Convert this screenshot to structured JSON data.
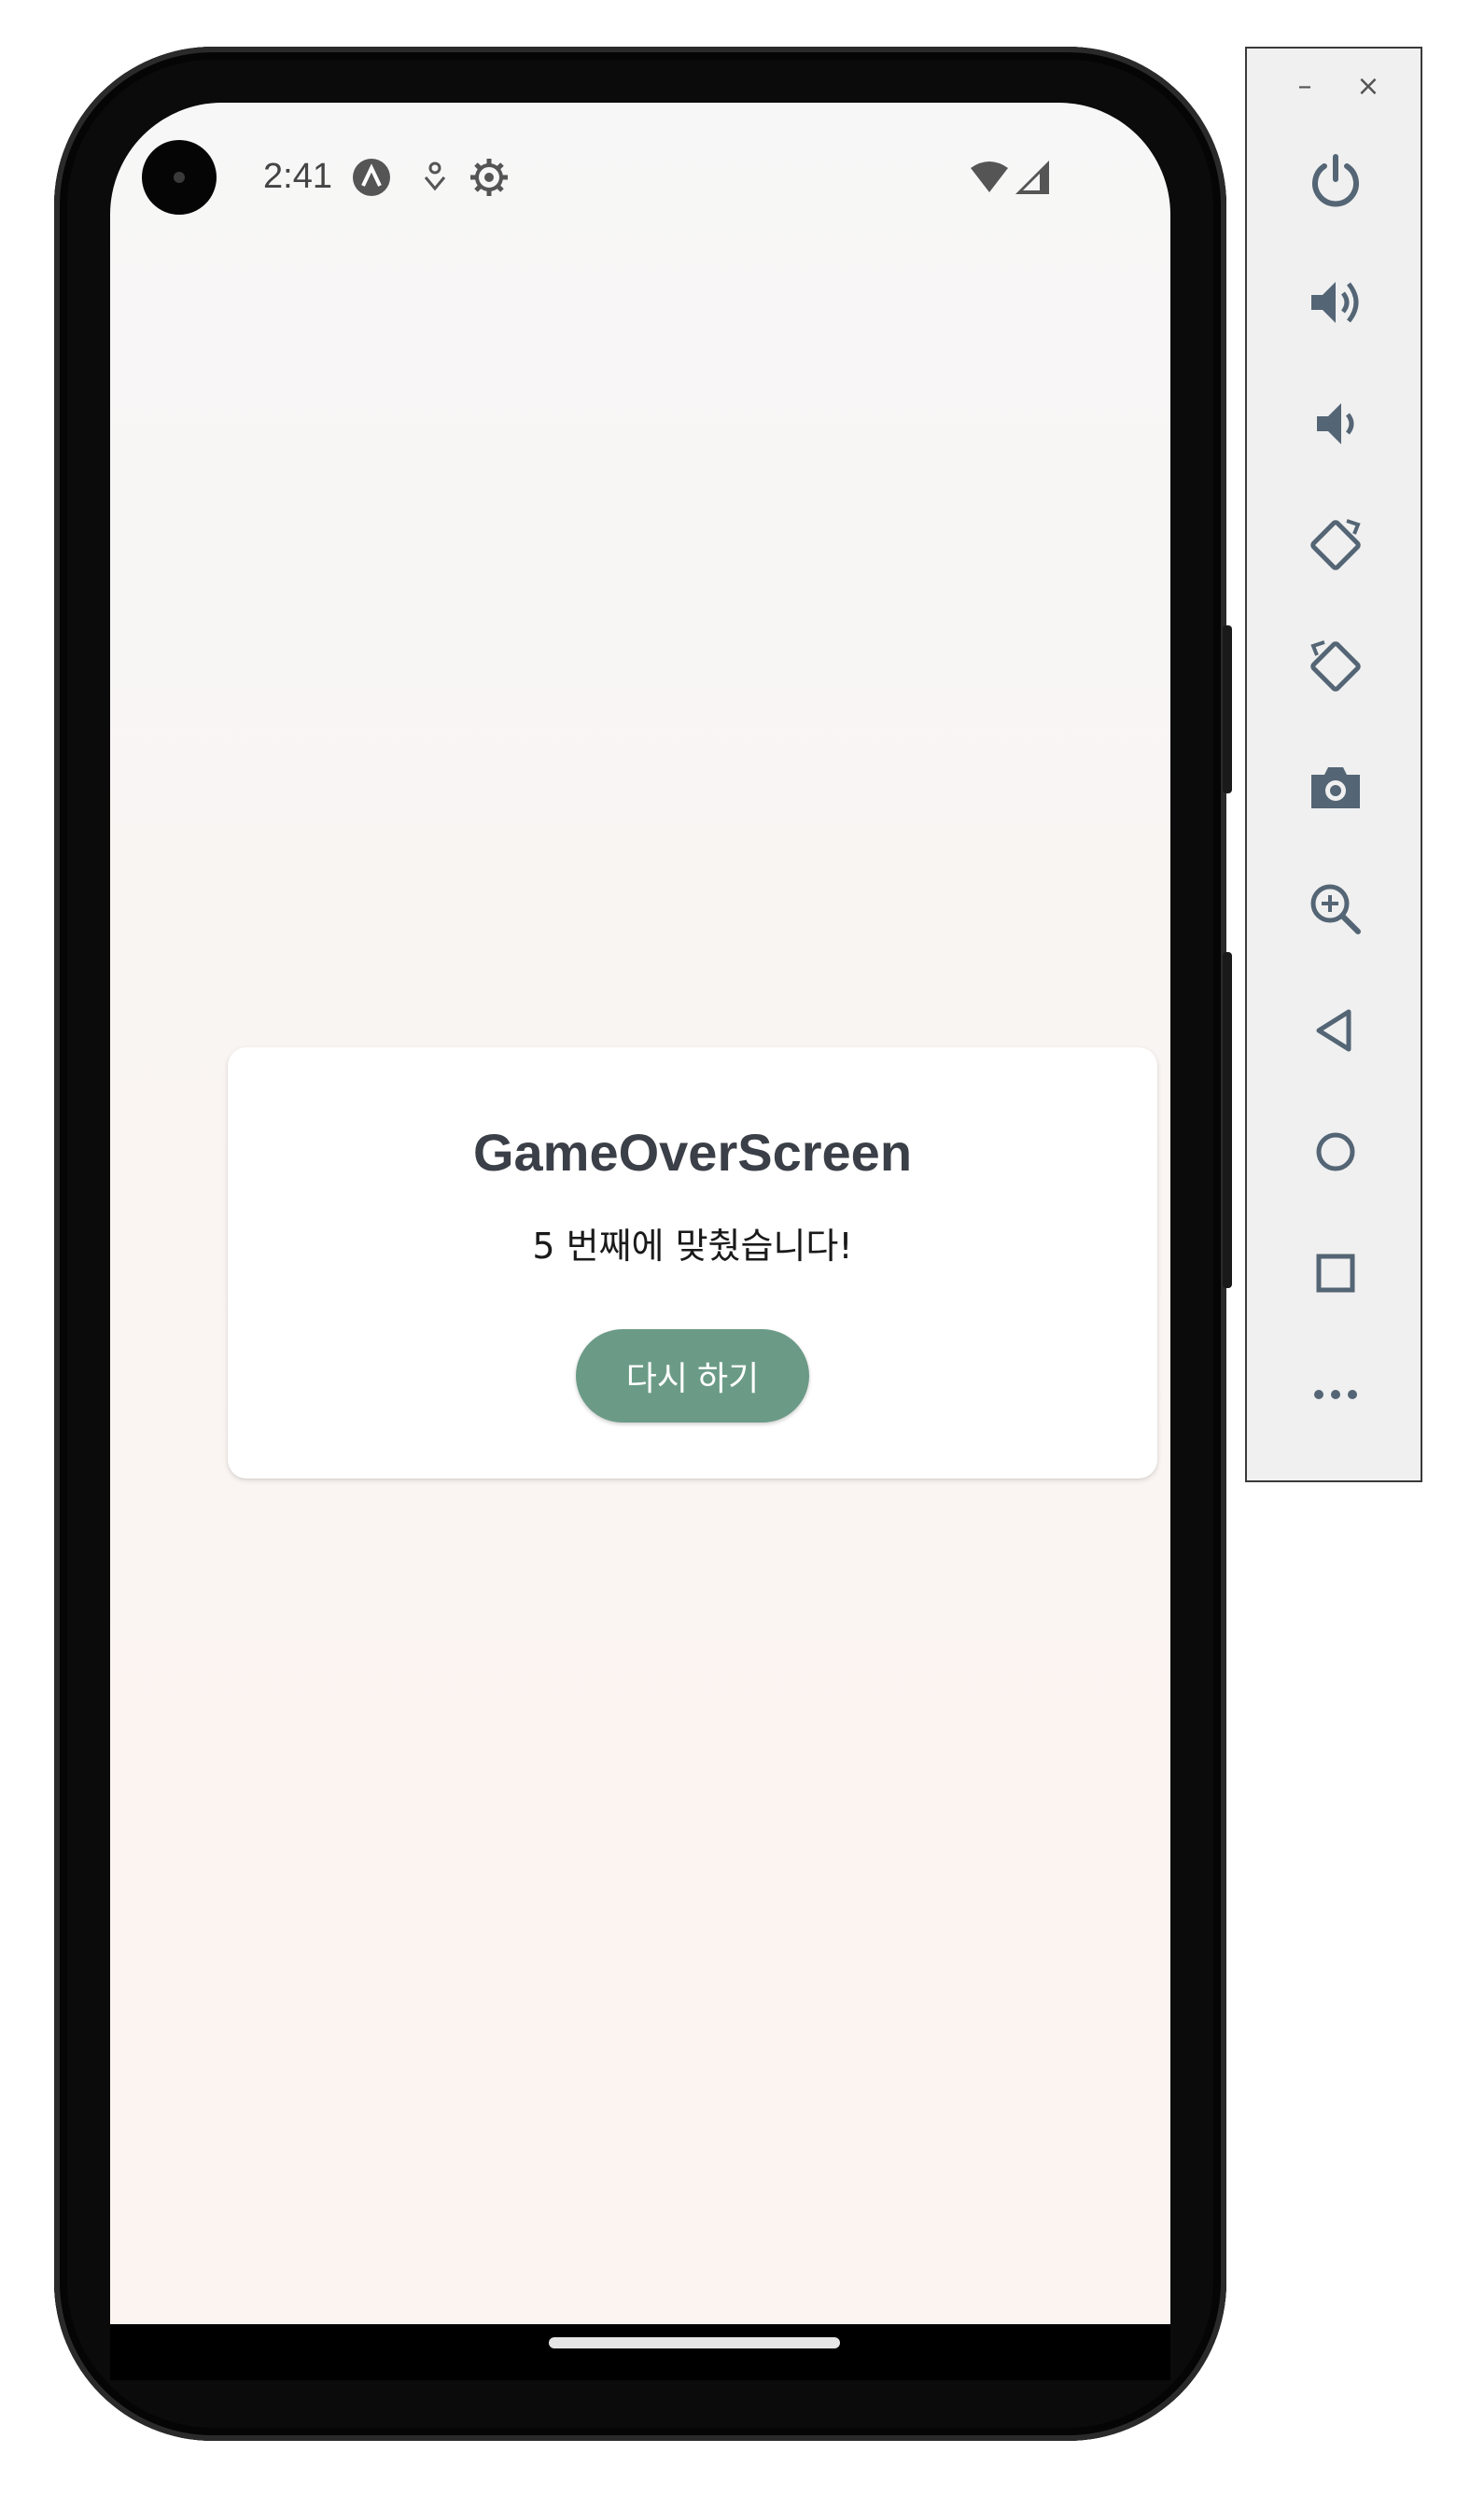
{
  "status_bar": {
    "time": "2:41",
    "icons": [
      "android-notification-icon",
      "download-icon",
      "settings-gear-icon",
      "wifi-icon",
      "cellular-signal-icon"
    ]
  },
  "dialog": {
    "title": "GameOverScreen",
    "message": "5 번째에 맞췄습니다!",
    "button_label": "다시 하기",
    "button_color": "#6b9b86"
  },
  "emulator_toolbar": {
    "window_controls": {
      "minimize": "–",
      "close": "×"
    },
    "buttons": [
      "power-icon",
      "volume-up-icon",
      "volume-down-icon",
      "rotate-left-icon",
      "rotate-right-icon",
      "screenshot-icon",
      "zoom-icon",
      "back-icon",
      "home-icon",
      "overview-icon",
      "more-icon"
    ]
  }
}
